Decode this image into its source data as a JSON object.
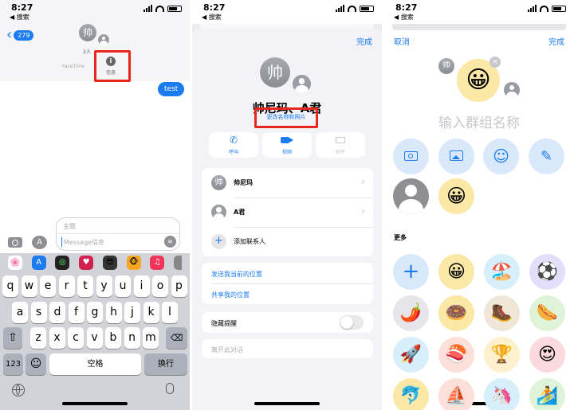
{
  "p1": {
    "time": "8:27",
    "back": "◀ 搜索",
    "unread": "279",
    "group_count": "2人",
    "facetime": "FaceTime",
    "info": "信息",
    "bubble": "test",
    "avatar_char": "帅",
    "subject": "主题",
    "message_placeholder": "Message信息",
    "keys_row1": [
      "q",
      "w",
      "e",
      "r",
      "t",
      "y",
      "u",
      "i",
      "o",
      "p"
    ],
    "keys_row2": [
      "a",
      "s",
      "d",
      "f",
      "g",
      "h",
      "j",
      "k",
      "l"
    ],
    "keys_row3": [
      "z",
      "x",
      "c",
      "v",
      "b",
      "n",
      "m"
    ],
    "num_key": "123",
    "space": "空格",
    "return": "换行"
  },
  "p2": {
    "time": "8:27",
    "back": "◀ 搜索",
    "done": "完成",
    "title": "帅尼玛、A君",
    "change": "更改名称和照片",
    "avatar_char": "帅",
    "actions": [
      "呼叫",
      "视频",
      "邮件"
    ],
    "contacts": [
      {
        "avatar": "帅",
        "name": "帅尼玛"
      },
      {
        "avatar": "",
        "name": "A君"
      }
    ],
    "add_contact": "添加联系人",
    "send_location": "发送我当前的位置",
    "share_location": "共享我的位置",
    "hide_alerts": "隐藏提醒",
    "leave": "离开此对话"
  },
  "p3": {
    "time": "8:27",
    "back": "◀ 搜索",
    "cancel": "取消",
    "done": "完成",
    "name_placeholder": "输入群组名称",
    "small_avatar": "帅",
    "more": "更多",
    "emoji_main": "😀",
    "grid_row1": [
      "+",
      "😀",
      "🏖️",
      "⚽"
    ],
    "grid_row2": [
      "🌶️",
      "🍩",
      "🥾",
      "🌭"
    ],
    "grid_row3": [
      "🚀",
      "🍣",
      "🏆",
      "😍"
    ],
    "grid_row4": [
      "🐬",
      "⛵",
      "🦄",
      "🏄"
    ]
  },
  "colors": {
    "accent": "#1a7cf0",
    "red_highlight": "#e8271c"
  }
}
